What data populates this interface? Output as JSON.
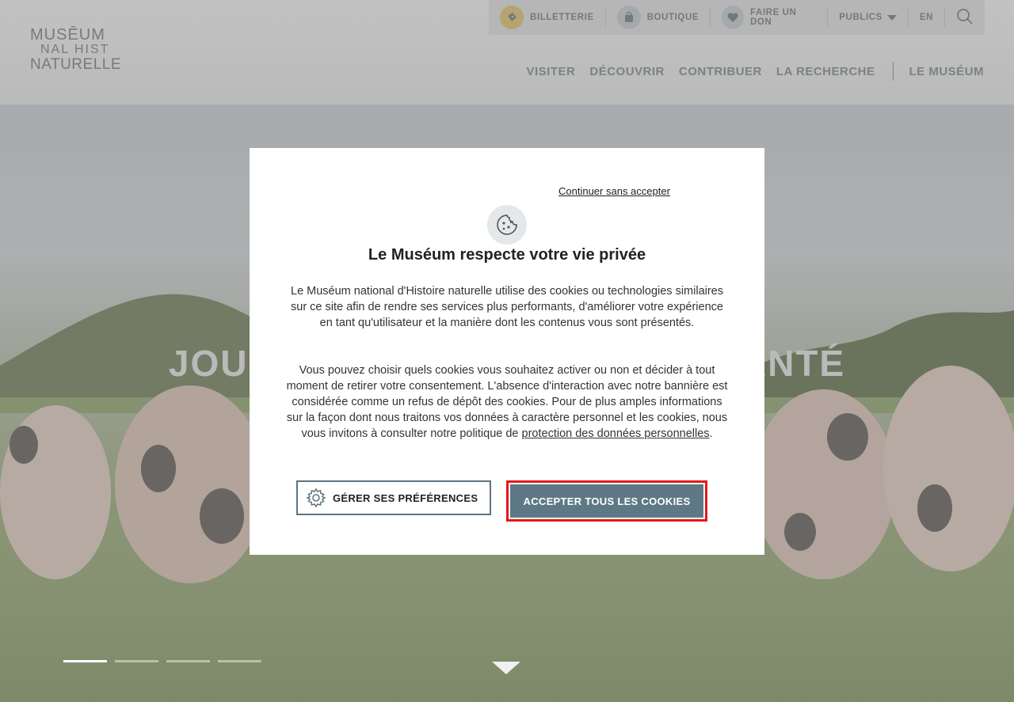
{
  "logo": {
    "line1": "MUSĒUM",
    "line2": "NAL HIST",
    "line3": "NATURELLE"
  },
  "topbar": {
    "items": [
      {
        "label": "BILLETTERIE",
        "icon": "ticket-icon",
        "color": "#e8c96a"
      },
      {
        "label": "BOUTIQUE",
        "icon": "shopping-bag-icon",
        "color": "#c8d3d8"
      },
      {
        "label": "FAIRE UN DON",
        "icon": "heart-icon",
        "color": "#c8d3d8"
      }
    ],
    "publics": "PUBLICS",
    "lang": "EN",
    "search_icon": "search-icon"
  },
  "nav": {
    "items": [
      "VISITER",
      "DÉCOUVRIR",
      "CONTRIBUER",
      "LA RECHERCHE"
    ],
    "museum": "LE MUSÉUM"
  },
  "hero": {
    "title": "JOURNÉE MONDIALE DE LA SANTÉ",
    "slides_total": 4,
    "slide_active": 1
  },
  "modal": {
    "skip": "Continuer sans accepter",
    "title": "Le Muséum respecte votre vie privée",
    "paragraph1": "Le Muséum national d'Histoire naturelle utilise des cookies ou technologies similaires sur ce site afin de rendre ses services plus performants, d'améliorer votre expérience en tant qu'utilisateur et la manière dont les contenus vous sont présentés.",
    "paragraph2": "Vous pouvez choisir quels cookies vous souhaitez activer ou non et décider à tout moment de retirer votre consentement. L'absence d'interaction avec notre bannière est considérée comme un refus de dépôt des cookies. Pour de plus amples informations sur la façon dont nous traitons vos données à caractère personnel et les cookies, nous vous invitons à consulter notre politique de",
    "link": "protection des données personnelles",
    "link_suffix": ".",
    "btn_preferences": "GÉRER SES PRÉFÉRENCES",
    "btn_accept": "ACCEPTER TOUS LES COOKIES"
  },
  "colors": {
    "accent": "#5e7985",
    "highlight": "#e11919"
  }
}
